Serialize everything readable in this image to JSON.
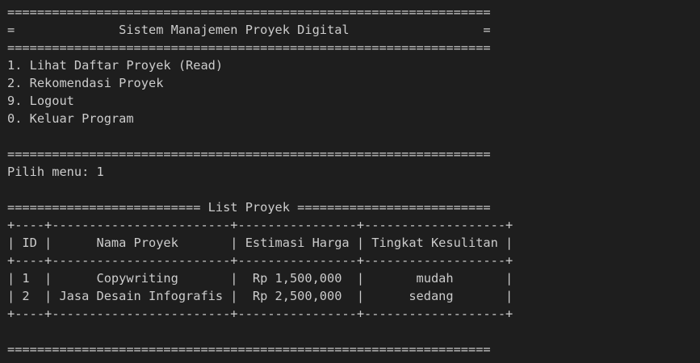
{
  "terminal": {
    "background": "#1e1e1e",
    "foreground": "#cccccc",
    "lines": [
      "=================================================================",
      "=              Sistem Manajemen Proyek Digital                  =",
      "=================================================================",
      "1. Lihat Daftar Proyek (Read)",
      "2. Rekomendasi Proyek",
      "9. Logout",
      "0. Keluar Program",
      "",
      "=================================================================",
      "Pilih menu: 1",
      "",
      "========================== List Proyek ==========================",
      "+----+------------------------+----------------+-------------------+",
      "| ID |      Nama Proyek       | Estimasi Harga | Tingkat Kesulitan |",
      "+----+------------------------+----------------+-------------------+",
      "| 1  |      Copywriting       |  Rp 1,500,000  |       mudah       |",
      "| 2  | Jasa Desain Infografis |  Rp 2,500,000  |      sedang       |",
      "+----+------------------------+----------------+-------------------+",
      "",
      "================================================================="
    ]
  }
}
